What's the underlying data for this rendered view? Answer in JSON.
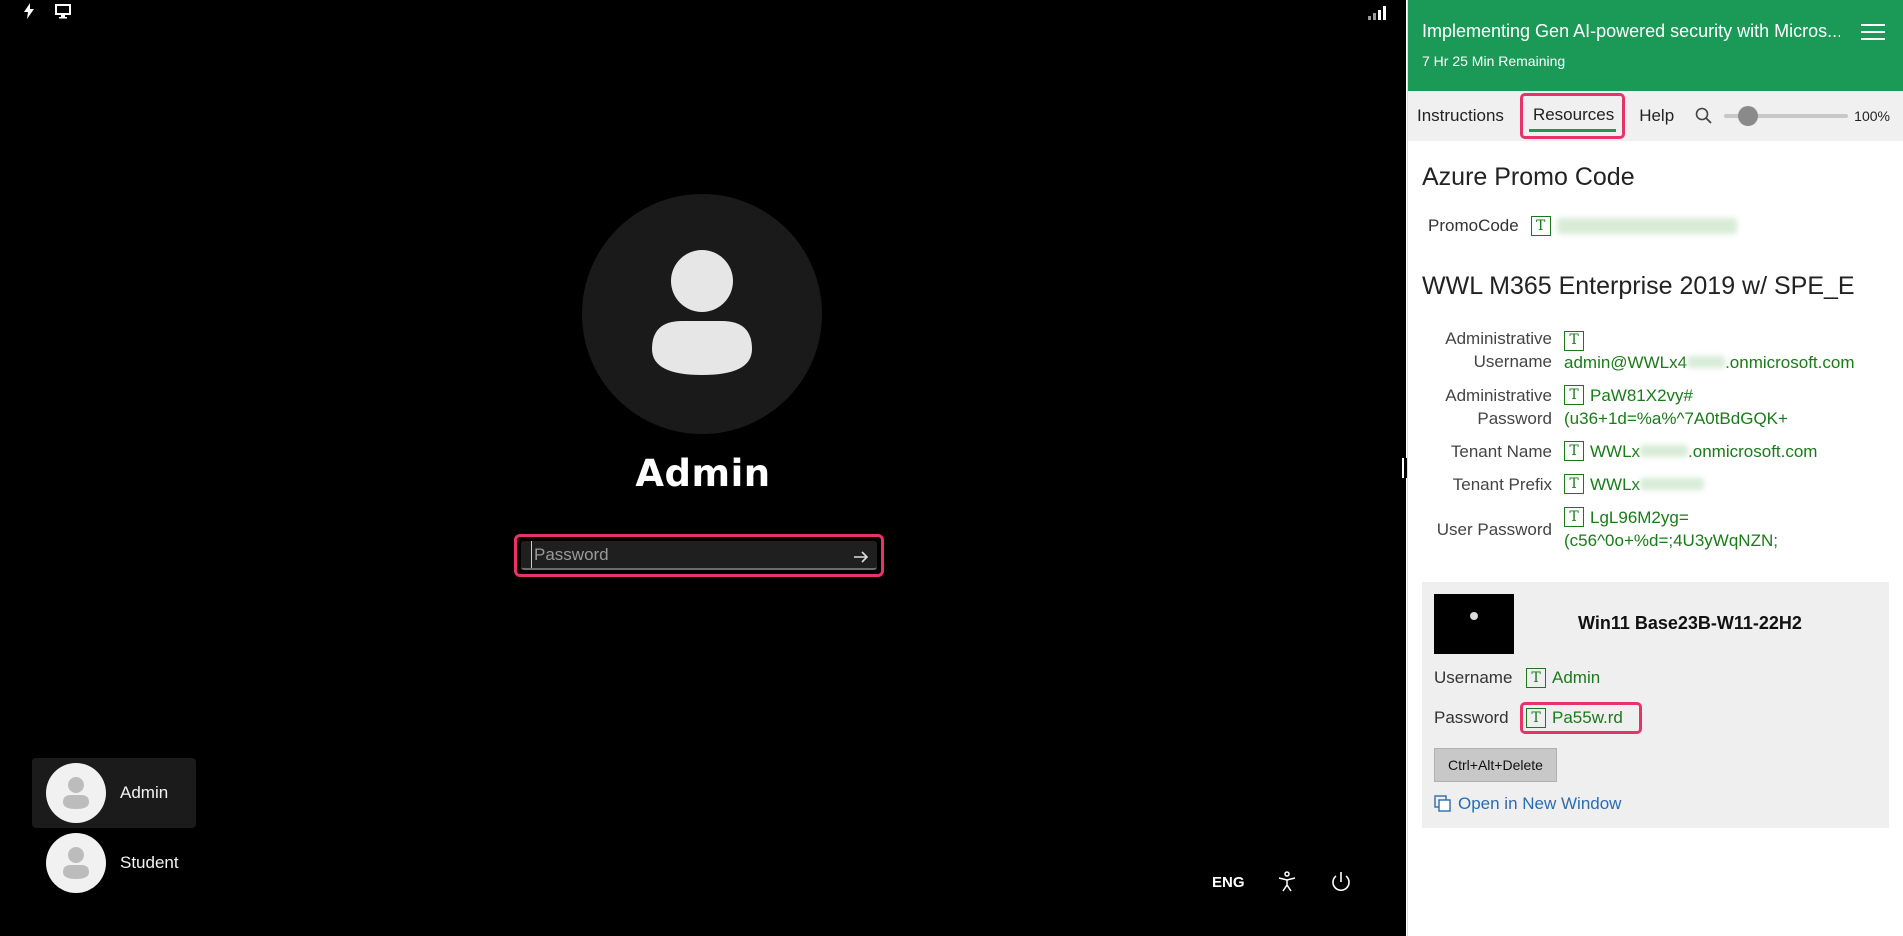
{
  "vm": {
    "user_name": "Admin",
    "password_placeholder": "Password",
    "users": [
      {
        "name": "Admin"
      },
      {
        "name": "Student"
      }
    ],
    "language": "ENG"
  },
  "panel": {
    "title": "Implementing Gen AI-powered security with Micros...",
    "remaining": "7 Hr 25 Min Remaining",
    "tabs": {
      "instructions": "Instructions",
      "resources": "Resources",
      "help": "Help"
    },
    "zoom": "100%",
    "zoom_level": 0.13,
    "promo": {
      "heading": "Azure Promo Code",
      "label": "PromoCode"
    },
    "tenant": {
      "heading": "WWL M365 Enterprise 2019 w/ SPE_E",
      "admin_user_label_1": "Administrative",
      "admin_user_label_2": "Username",
      "admin_user_value": "admin@WWLx4",
      "admin_user_value_tail": ".onmicrosoft.com",
      "admin_pw_label_1": "Administrative",
      "admin_pw_label_2": "Password",
      "admin_pw_value_1": "PaW81X2vy#",
      "admin_pw_value_2": "(u36+1d=%a%^7A0tBdGQK+",
      "tenant_name_label": "Tenant Name",
      "tenant_name_value": "WWLx",
      "tenant_name_tail": ".onmicrosoft.com",
      "tenant_prefix_label": "Tenant Prefix",
      "tenant_prefix_value": "WWLx",
      "user_pw_label": "User Password",
      "user_pw_value_1": "LgL96M2yg=",
      "user_pw_value_2": "(c56^0o+%d=;4U3yWqNZN;"
    },
    "vm_card": {
      "name": "Win11 Base23B-W11-22H2",
      "username_label": "Username",
      "username_value": "Admin",
      "password_label": "Password",
      "password_value": "Pa55w.rd",
      "cad_button": "Ctrl+Alt+Delete",
      "open_link": "Open in New Window"
    }
  },
  "colors": {
    "header_green": "#1a9a56",
    "highlight_pink": "#e8336a",
    "value_green": "#1a7a1a",
    "link_blue": "#2b6cb0"
  }
}
